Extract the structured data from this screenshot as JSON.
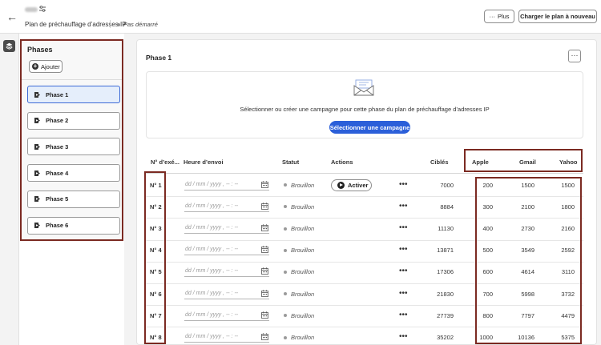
{
  "header": {
    "plan_title": "Plan de préchauffage d’adresses IP",
    "status": "Pas démarré",
    "more_label": "Plus",
    "reload_label": "Charger le plan à nouveau"
  },
  "phases_panel": {
    "heading": "Phases",
    "add_label": "Ajouter",
    "items": [
      {
        "label": "Phase 1",
        "selected": true
      },
      {
        "label": "Phase 2"
      },
      {
        "label": "Phase 3"
      },
      {
        "label": "Phase 4"
      },
      {
        "label": "Phase 5"
      },
      {
        "label": "Phase 6"
      }
    ]
  },
  "main": {
    "title": "Phase 1",
    "empty_text": "Sélectionner ou créer une campagne pour cette phase du plan de préchauffage d’adresses IP",
    "select_campaign_label": "Sélectionner une campagne",
    "columns": {
      "exec": "N° d’exé...",
      "send_time": "Heure d’envoi",
      "status": "Statut",
      "actions": "Actions",
      "targets": "Ciblés",
      "apple": "Apple",
      "gmail": "Gmail",
      "yahoo": "Yahoo"
    },
    "date_placeholder": "dd / mm / yyyy ,  -- : --",
    "activate_label": "Activer",
    "more_glyph": "•••",
    "rows": [
      {
        "exec": "N° 1",
        "status": "Brouillon",
        "targets": "7000",
        "apple": "200",
        "gmail": "1500",
        "yahoo": "1500",
        "has_activate": true
      },
      {
        "exec": "N° 2",
        "status": "Brouillon",
        "targets": "8884",
        "apple": "300",
        "gmail": "2100",
        "yahoo": "1800"
      },
      {
        "exec": "N° 3",
        "status": "Brouillon",
        "targets": "11130",
        "apple": "400",
        "gmail": "2730",
        "yahoo": "2160"
      },
      {
        "exec": "N° 4",
        "status": "Brouillon",
        "targets": "13871",
        "apple": "500",
        "gmail": "3549",
        "yahoo": "2592"
      },
      {
        "exec": "N° 5",
        "status": "Brouillon",
        "targets": "17306",
        "apple": "600",
        "gmail": "4614",
        "yahoo": "3110"
      },
      {
        "exec": "N° 6",
        "status": "Brouillon",
        "targets": "21830",
        "apple": "700",
        "gmail": "5998",
        "yahoo": "3732"
      },
      {
        "exec": "N° 7",
        "status": "Brouillon",
        "targets": "27739",
        "apple": "800",
        "gmail": "7797",
        "yahoo": "4479"
      },
      {
        "exec": "N° 8",
        "status": "Brouillon",
        "targets": "35202",
        "apple": "1000",
        "gmail": "10136",
        "yahoo": "5375"
      }
    ]
  },
  "icons": {
    "back": "back-arrow-icon",
    "settings": "sliders-icon",
    "layers": "layers-icon",
    "phase": "campaign-icon",
    "envelope": "envelope-icon",
    "calendar": "calendar-icon"
  },
  "colors": {
    "accent": "#2b5fd9",
    "highlight": "#7b2a22",
    "selected_bg": "#e5eefb"
  }
}
